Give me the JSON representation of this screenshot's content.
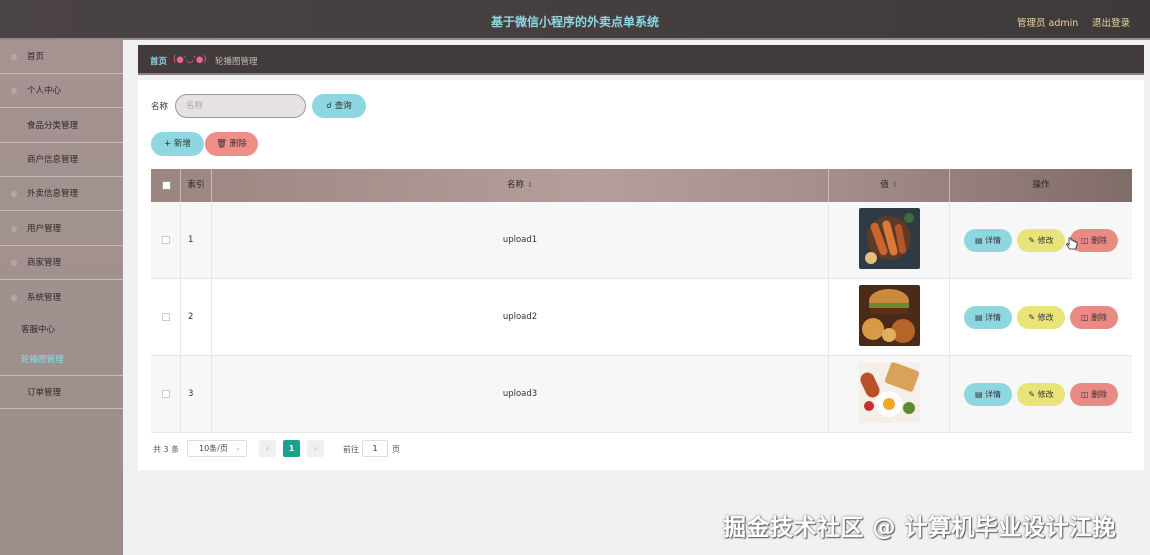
{
  "header": {
    "title": "基于微信小程序的外卖点单系统",
    "admin": "管理员 admin",
    "logout": "退出登录"
  },
  "sidebar": {
    "items": [
      {
        "label": "首页"
      },
      {
        "label": "个人中心"
      },
      {
        "label": "食品分类管理"
      },
      {
        "label": "商户信息管理"
      },
      {
        "label": "外卖信息管理"
      },
      {
        "label": "用户管理"
      },
      {
        "label": "商家管理"
      },
      {
        "label": "系统管理"
      }
    ],
    "sub": [
      {
        "label": "客服中心"
      },
      {
        "label": "轮播图管理"
      }
    ],
    "last": {
      "label": "订单管理"
    }
  },
  "breadcrumb": {
    "home": "首页",
    "emoticon": "(●'◡'●)",
    "current": "轮播图管理"
  },
  "search": {
    "label": "名称",
    "placeholder": "名称",
    "query_label": "查询"
  },
  "actions": {
    "add_label": "新增",
    "delete_label": "删除"
  },
  "table": {
    "columns": [
      "索引",
      "名称",
      "值",
      "操作"
    ],
    "rows": [
      {
        "index": "1",
        "name": "upload1"
      },
      {
        "index": "2",
        "name": "upload2"
      },
      {
        "index": "3",
        "name": "upload3"
      }
    ],
    "ops": {
      "detail": "详情",
      "edit": "修改",
      "remove": "删除"
    }
  },
  "pagination": {
    "total": "共 3 条",
    "page_size": "10条/页",
    "current": "1",
    "goto": "前往",
    "goto_value": "1",
    "unit": "页"
  },
  "watermark": "掘金技术社区 @ 计算机毕业设计江挽",
  "colors": {
    "accent": "#8fd7e0",
    "danger": "#ea8a84",
    "warning": "#e8e47a",
    "active_page": "#19a28c"
  }
}
